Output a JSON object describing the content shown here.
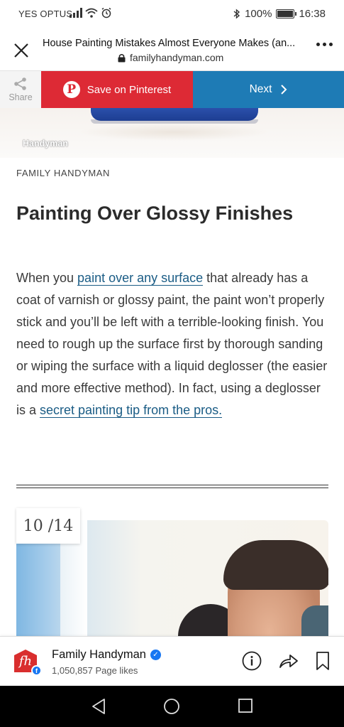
{
  "status_bar": {
    "carrier": "YES OPTUS",
    "battery_level": 100,
    "battery_text": "100%",
    "time": "16:38"
  },
  "browser": {
    "title": "House Painting Mistakes Almost Everyone Makes (an...",
    "url": "familyhandyman.com"
  },
  "share_bar": {
    "share_label": "Share",
    "pinterest_label": "Save on Pinterest",
    "pinterest_letter": "P",
    "next_label": "Next",
    "colors": {
      "pinterest": "#dd2a35",
      "next": "#1e7bb5"
    }
  },
  "article": {
    "image_watermark": "Handyman",
    "credit": "FAMILY HANDYMAN",
    "headline": "Painting Over Glossy Finishes",
    "body": {
      "part1": "When you ",
      "link1": "paint over any surface",
      "part2": " that already has a coat of varnish or glossy paint, the paint won’t properly stick and you’ll be left with a terrible-looking finish. You need to rough up the surface first by thorough sanding or wiping the surface with a liquid deglosser (the easier and more effective method). In fact, using a deglosser is a ",
      "link2": "secret painting tip from the pros."
    },
    "slide_counter": "10 /14"
  },
  "footer": {
    "logo_text": "fh",
    "page_name": "Family Handyman",
    "page_likes": "1,050,857 Page likes",
    "actions": [
      "info-icon",
      "share-icon",
      "bookmark-icon"
    ]
  },
  "nav": [
    "back-icon",
    "home-icon",
    "recents-icon"
  ]
}
